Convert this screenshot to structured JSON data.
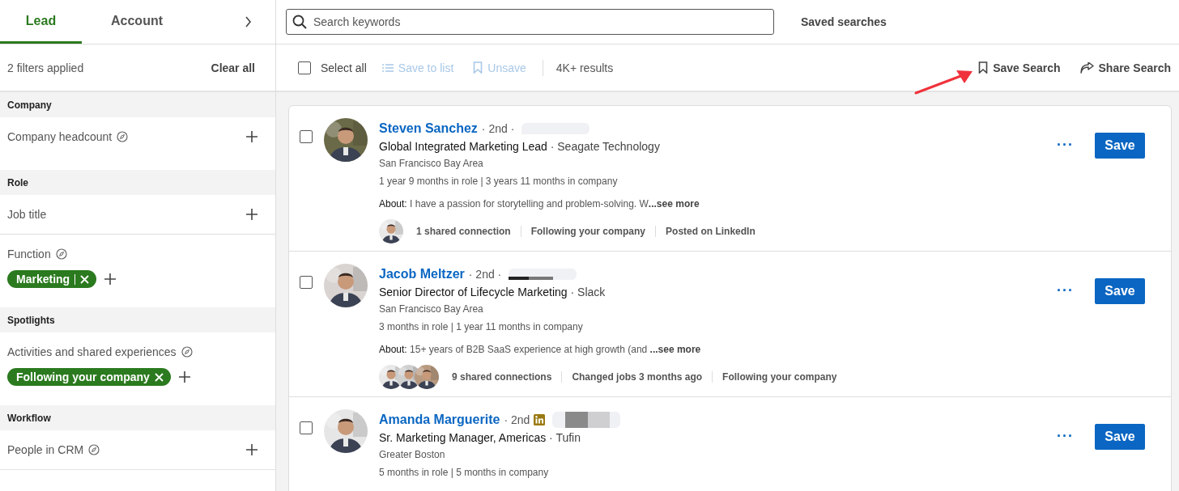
{
  "sidebar": {
    "tabs": [
      {
        "label": "Lead",
        "selected": true
      },
      {
        "label": "Account",
        "selected": false
      }
    ],
    "filters_applied": "2 filters applied",
    "clear_all": "Clear all",
    "sections": [
      {
        "title": "Company",
        "filters": [
          {
            "label": "Company headcount",
            "info": true
          }
        ]
      },
      {
        "title": "Role",
        "filters": [
          {
            "label": "Job title",
            "info": false
          },
          {
            "label": "Function",
            "info": true,
            "chips": [
              {
                "label": "Marketing",
                "divider": true
              }
            ]
          }
        ]
      },
      {
        "title": "Spotlights",
        "filters": [
          {
            "label": "Activities and shared experiences",
            "info": true,
            "chips": [
              {
                "label": "Following your company",
                "divider": false
              }
            ]
          }
        ]
      },
      {
        "title": "Workflow",
        "filters": [
          {
            "label": "People in CRM",
            "info": true
          }
        ]
      }
    ]
  },
  "search": {
    "placeholder": "Search keywords"
  },
  "saved_searches": "Saved searches",
  "toolbar": {
    "select_all": {
      "label": "Select all",
      "checked": false
    },
    "actions": [
      {
        "label": "Save to list",
        "kind": "list",
        "disabled": true
      },
      {
        "label": "Unsave",
        "kind": "bookmark",
        "disabled": true
      }
    ],
    "results": "4K+ results",
    "search_actions": [
      {
        "label": "Save Search",
        "kind": "bookmark"
      },
      {
        "label": "Share Search",
        "kind": "share"
      }
    ]
  },
  "leads": [
    {
      "name": "Steven Sanchez",
      "degree": "· 2nd ·",
      "premium": false,
      "redacted": true,
      "selected": false,
      "title": "Global Integrated Marketing Lead",
      "company": "· Seagate Technology",
      "location": "San Francisco Bay Area",
      "tenure": "1 year 9 months in role | 3 years 11 months in company",
      "about_label": "About:",
      "about": "I have a passion for storytelling and problem-solving. W",
      "see_more": "...see more",
      "shared_avatars": [
        {
          "kind": "picture"
        }
      ],
      "insights": [
        "1 shared connection",
        "Following your company",
        "Posted on LinkedIn"
      ],
      "more": "···",
      "save": "Save"
    },
    {
      "name": "Jacob Meltzer",
      "degree": "· 2nd ·",
      "premium": false,
      "redacted": true,
      "selected": false,
      "title": "Senior Director of Lifecycle Marketing",
      "company": "· Slack",
      "location": "San Francisco Bay Area",
      "tenure": "3 months in role | 1 year 11 months in company",
      "about_label": "About:",
      "about": "15+ years of B2B SaaS experience at high growth (and ",
      "see_more": "...see more",
      "shared_avatars": [
        {
          "kind": "picture"
        },
        {
          "kind": "picture"
        },
        {
          "kind": "picture"
        }
      ],
      "insights": [
        "9 shared connections",
        "Changed jobs 3 months ago",
        "Following your company"
      ],
      "more": "···",
      "save": "Save"
    },
    {
      "name": "Amanda Marguerite",
      "degree": "· 2nd",
      "premium": true,
      "redacted": true,
      "selected": false,
      "title": "Sr. Marketing Manager, Americas",
      "company": "· Tufin",
      "location": "Greater Boston",
      "tenure": "5 months in role | 5 months in company",
      "more": "···",
      "save": "Save"
    }
  ]
}
